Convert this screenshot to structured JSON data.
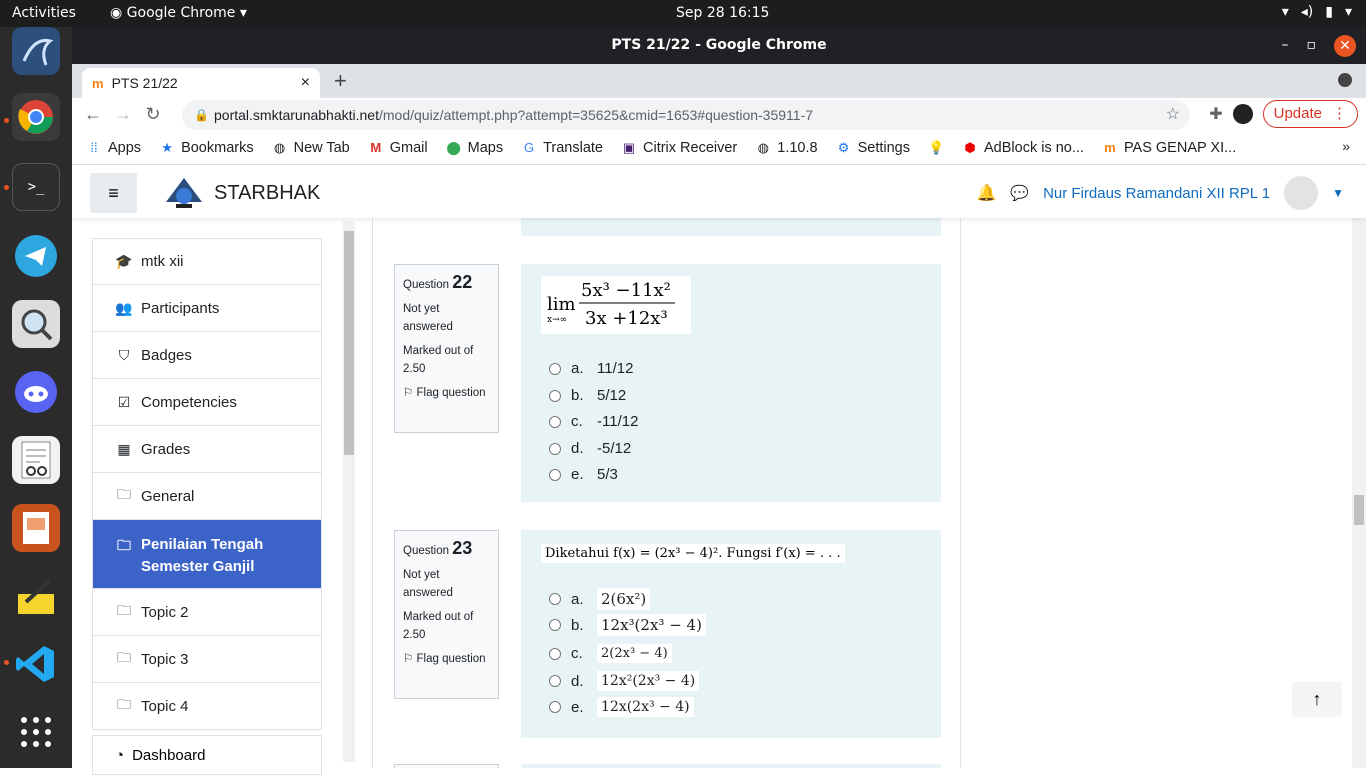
{
  "topbar": {
    "activities": "Activities",
    "app": "Google Chrome",
    "clock": "Sep 28  16:15"
  },
  "window": {
    "title": "PTS 21/22 - Google Chrome"
  },
  "tab": {
    "title": "PTS 21/22",
    "close": "×",
    "newtab": "+"
  },
  "omnibox": {
    "host": "portal.smktarunabhakti.net",
    "path": "/mod/quiz/attempt.php?attempt=35625&cmid=1653#question-35911-7"
  },
  "update": {
    "label": "Update"
  },
  "bookmarks": [
    {
      "label": "Apps",
      "icon": "apps-icon"
    },
    {
      "label": "Bookmarks",
      "icon": "star-icon"
    },
    {
      "label": "New Tab",
      "icon": "globe-icon"
    },
    {
      "label": "Gmail",
      "icon": "gmail-icon"
    },
    {
      "label": "Maps",
      "icon": "maps-icon"
    },
    {
      "label": "Translate",
      "icon": "translate-icon"
    },
    {
      "label": "Citrix Receiver",
      "icon": "citrix-icon"
    },
    {
      "label": "1.10.8",
      "icon": "globe-icon"
    },
    {
      "label": "Settings",
      "icon": "gear-icon"
    },
    {
      "label": "",
      "icon": "bulb-icon"
    },
    {
      "label": "AdBlock is no...",
      "icon": "adblock-icon"
    },
    {
      "label": "PAS GENAP XI...",
      "icon": "moodle-icon"
    }
  ],
  "moodle": {
    "site": "STARBHAK",
    "user": "Nur Firdaus Ramandani XII RPL 1"
  },
  "nav": [
    {
      "label": "mtk xii",
      "icon": "graduation-cap-icon"
    },
    {
      "label": "Participants",
      "icon": "users-icon"
    },
    {
      "label": "Badges",
      "icon": "shield-icon"
    },
    {
      "label": "Competencies",
      "icon": "checkbox-icon"
    },
    {
      "label": "Grades",
      "icon": "table-icon"
    },
    {
      "label": "General",
      "icon": "folder-icon"
    },
    {
      "label": "Penilaian Tengah Semester Ganjil",
      "icon": "folder-icon"
    },
    {
      "label": "Topic 2",
      "icon": "folder-icon"
    },
    {
      "label": "Topic 3",
      "icon": "folder-icon"
    },
    {
      "label": "Topic 4",
      "icon": "folder-icon"
    }
  ],
  "dashboard": "Dashboard",
  "q22": {
    "prefix": "Question",
    "number": "22",
    "status": "Not yet answered",
    "marked": "Marked out of 2.50",
    "flag": "Flag question",
    "options": [
      {
        "letter": "a.",
        "text": "11/12"
      },
      {
        "letter": "b.",
        "text": "5/12"
      },
      {
        "letter": "c.",
        "text": "-11/12"
      },
      {
        "letter": "d.",
        "text": "-5/12"
      },
      {
        "letter": "e.",
        "text": "5/3"
      }
    ]
  },
  "q23": {
    "prefix": "Question",
    "number": "23",
    "status": "Not yet answered",
    "marked": "Marked out of 2.50",
    "flag": "Flag question",
    "prompt": "Diketahui f(x) = (2x³ − 4)². Fungsi f′(x) = . . .",
    "options": [
      {
        "letter": "a.",
        "text": "2(6x²)"
      },
      {
        "letter": "b.",
        "text": "12x³(2x³ − 4)"
      },
      {
        "letter": "c.",
        "text": "2(2x³ − 4)"
      },
      {
        "letter": "d.",
        "text": "12x²(2x³ − 4)"
      },
      {
        "letter": "e.",
        "text": "12x(2x³ − 4)"
      }
    ]
  }
}
